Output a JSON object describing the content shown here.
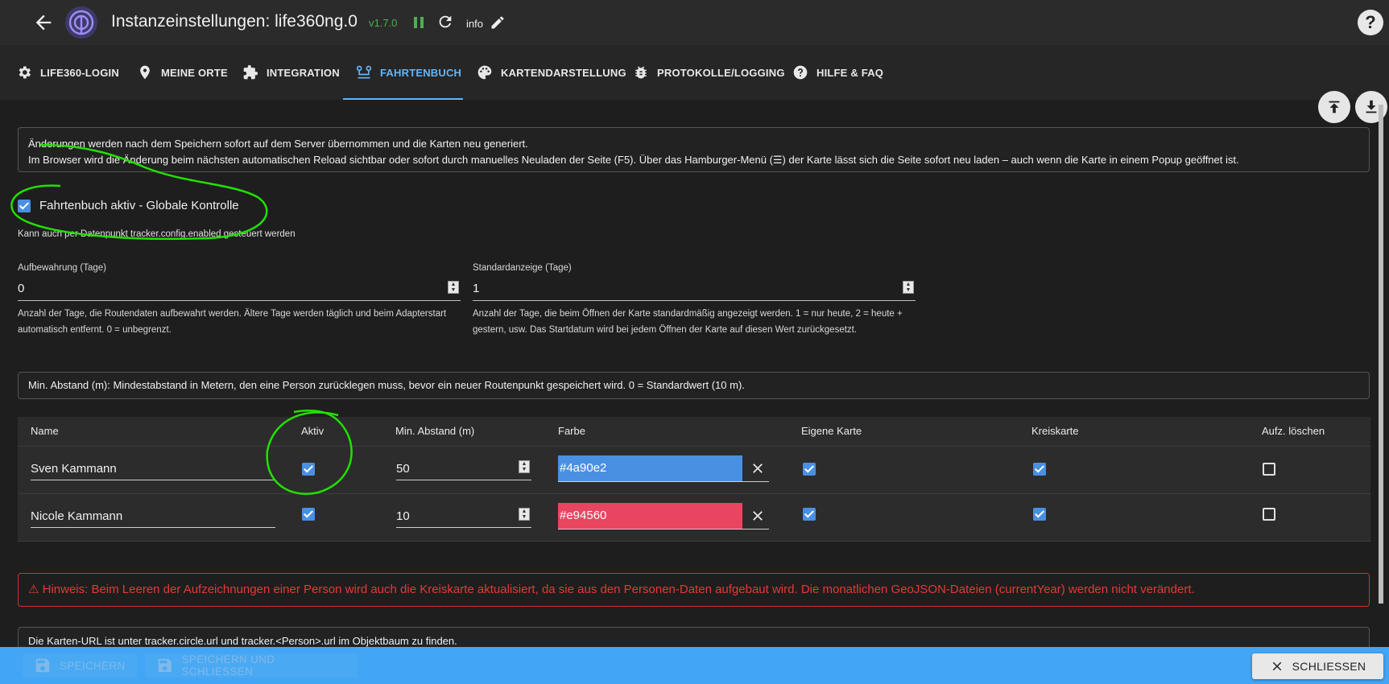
{
  "header": {
    "title": "Instanzeinstellungen:  life360ng.0",
    "version": "v1.7.0",
    "info_label": "info",
    "help_label": "?"
  },
  "tabs": [
    {
      "label": "LIFE360-LOGIN",
      "icon": "gear-icon"
    },
    {
      "label": "MEINE ORTE",
      "icon": "location-pin-icon"
    },
    {
      "label": "INTEGRATION",
      "icon": "puzzle-icon"
    },
    {
      "label": "FAHRTENBUCH",
      "icon": "route-icon",
      "active": true
    },
    {
      "label": "KARTENDARSTELLUNG",
      "icon": "palette-icon"
    },
    {
      "label": "PROTOKOLLE/LOGGING",
      "icon": "bug-icon"
    },
    {
      "label": "HILFE & FAQ",
      "icon": "help-circle-icon"
    }
  ],
  "info1": {
    "line1": "Änderungen werden nach dem Speichern sofort auf dem Server übernommen und die Karten neu generiert.",
    "line2": "Im Browser wird die Änderung beim nächsten automatischen Reload sichtbar oder sofort durch manuelles Neuladen der Seite (F5). Über das Hamburger-Menü (☰) der Karte lässt sich die Seite sofort neu laden – auch wenn die Karte in einem Popup geöffnet ist."
  },
  "enable": {
    "label": "Fahrtenbuch aktiv - Globale Kontrolle",
    "checked": true,
    "help": "Kann auch per Datenpunkt tracker.config.enabled gesteuert werden"
  },
  "retention": {
    "label": "Aufbewahrung (Tage)",
    "value": "0",
    "help": "Anzahl der Tage, die Routendaten aufbewahrt werden. Ältere Tage werden täglich und beim Adapterstart automatisch entfernt. 0 = unbegrenzt."
  },
  "default_view": {
    "label": "Standardanzeige (Tage)",
    "value": "1",
    "help": "Anzahl der Tage, die beim Öffnen der Karte standardmäßig angezeigt werden. 1 = nur heute, 2 = heute + gestern, usw. Das Startdatum wird bei jedem Öffnen der Karte auf diesen Wert zurückgesetzt."
  },
  "info2": "Min. Abstand (m): Mindestabstand in Metern, den eine Person zurücklegen muss, bevor ein neuer Routenpunkt gespeichert wird. 0 = Standardwert (10 m).",
  "table": {
    "headers": {
      "name": "Name",
      "active": "Aktiv",
      "min_distance": "Min. Abstand (m)",
      "color": "Farbe",
      "own_map": "Eigene Karte",
      "circle_map": "Kreiskarte",
      "clear": "Aufz. löschen"
    },
    "rows": [
      {
        "name": "Sven Kammann",
        "active": true,
        "min_distance": "50",
        "color": "#4a90e2",
        "own_map": true,
        "circle_map": true,
        "clear": false
      },
      {
        "name": "Nicole Kammann",
        "active": true,
        "min_distance": "10",
        "color": "#e94560",
        "own_map": true,
        "circle_map": true,
        "clear": false
      }
    ]
  },
  "warning": "⚠ Hinweis: Beim Leeren der Aufzeichnungen einer Person wird auch die Kreiskarte aktualisiert, da sie aus den Personen-Daten aufgebaut wird. Die monatlichen GeoJSON-Dateien (currentYear) werden nicht verändert.",
  "info3": "Die Karten-URL ist unter tracker.circle.url und tracker.<Person>.url im Objektbaum zu finden.",
  "footer": {
    "save": "SPEICHERN",
    "save_close": "SPEICHERN UND SCHLIESSEN",
    "close": "SCHLIESSEN"
  },
  "colors": {
    "accent": "#64b5f6",
    "version": "#4caf50",
    "warning": "#e53935",
    "footer_bg": "#42a5f5",
    "annotation": "#22e000"
  }
}
